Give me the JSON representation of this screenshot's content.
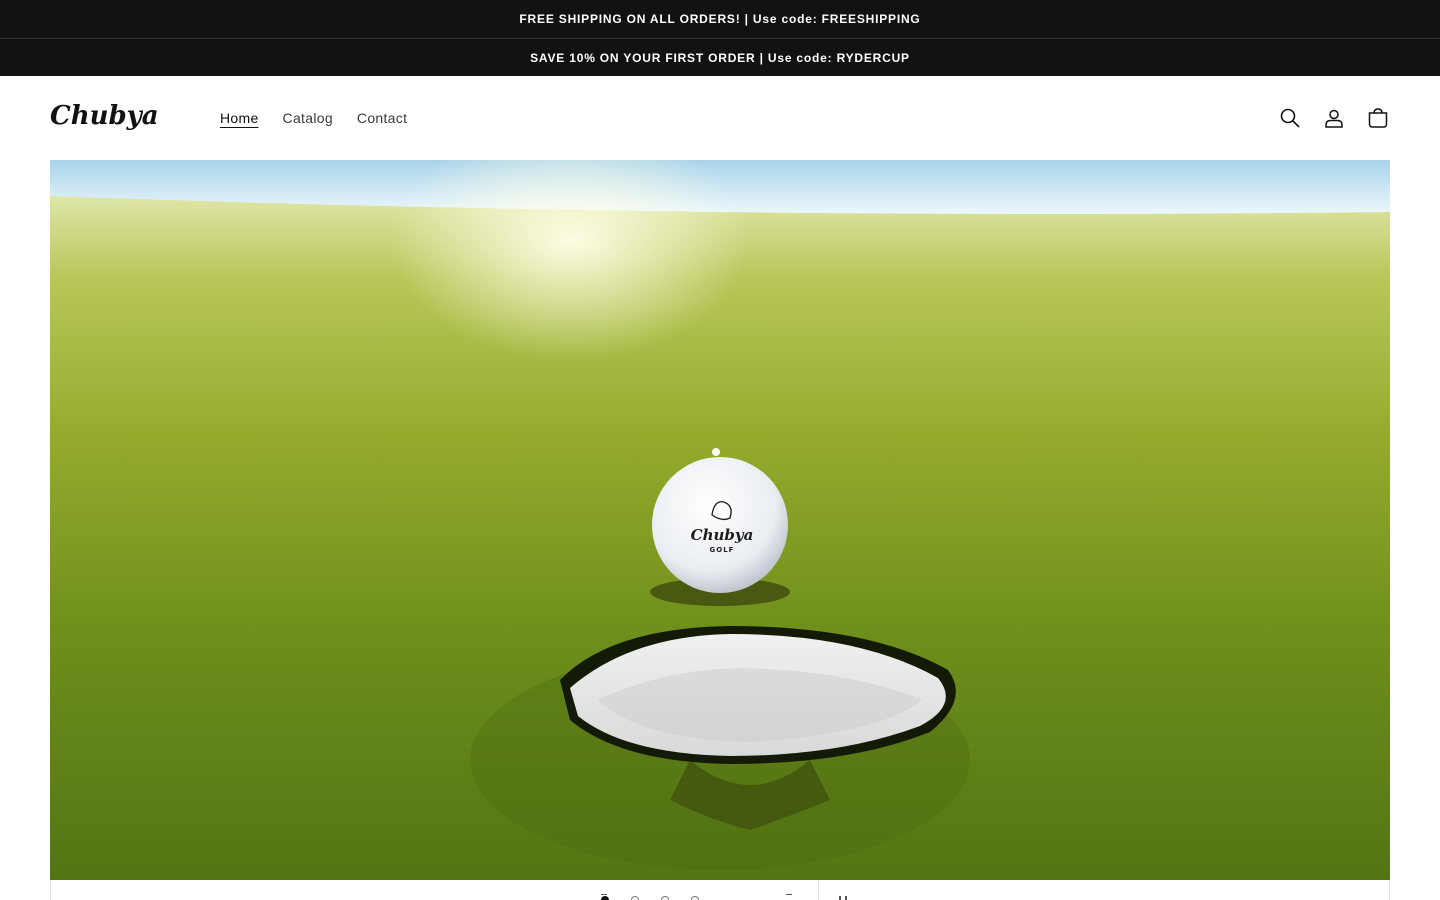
{
  "announcements": [
    "FREE SHIPPING ON ALL ORDERS! | Use code: FREESHIPPING",
    "SAVE 10% ON YOUR FIRST ORDER | Use code: RYDERCUP"
  ],
  "header": {
    "logo_text": "Chubya",
    "nav": [
      {
        "label": "Home",
        "active": true
      },
      {
        "label": "Catalog",
        "active": false
      },
      {
        "label": "Contact",
        "active": false
      }
    ],
    "icons": [
      "search-icon",
      "account-icon",
      "cart-icon"
    ]
  },
  "hero": {
    "image": "golf-ball-at-hole",
    "ball_brand": "Chubya",
    "ball_subtext": "GOLF"
  },
  "slideshow": {
    "slide_count": 4,
    "active_slide": 1
  },
  "colors": {
    "announcement_bg": "#121212",
    "text": "#121212",
    "grass": "#7a9a1e"
  }
}
